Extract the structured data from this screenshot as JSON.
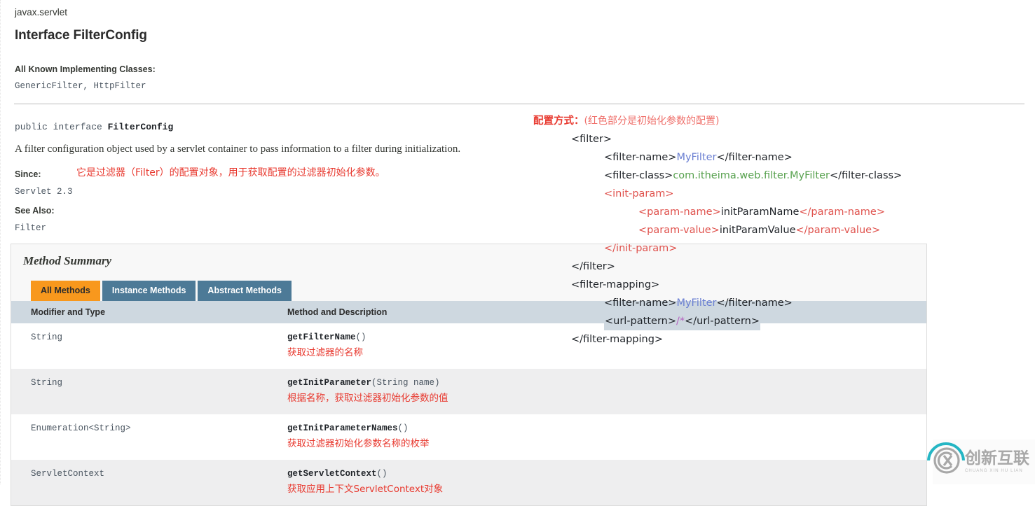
{
  "header": {
    "package": "javax.servlet",
    "title": "Interface FilterConfig",
    "known_label": "All Known Implementing Classes:",
    "known_classes": "GenericFilter, HttpFilter"
  },
  "declaration": {
    "modifiers": "public interface ",
    "name": "FilterConfig"
  },
  "description": "A filter configuration object used by a servlet container to pass information to a filter during initialization.",
  "details": {
    "since_label": "Since:",
    "since_value": "Servlet 2.3",
    "see_also_label": "See Also:",
    "see_also_value": "Filter",
    "since_note_cn": "它是过滤器（Filter）的配置对象，用于获取配置的过滤器初始化参数。"
  },
  "method_summary": {
    "caption": "Method Summary",
    "tabs": [
      {
        "label": "All Methods",
        "state": "active"
      },
      {
        "label": "Instance Methods",
        "state": "inactive"
      },
      {
        "label": "Abstract Methods",
        "state": "inactive"
      }
    ],
    "columns": [
      "Modifier and Type",
      "Method and Description"
    ],
    "rows": [
      {
        "type": "String",
        "method_name": "getFilterName",
        "method_args": "()",
        "note_cn": "获取过滤器的名称"
      },
      {
        "type": "String",
        "method_name": "getInitParameter",
        "method_args": "(String  name)",
        "note_cn": "根据名称，获取过滤器初始化参数的值"
      },
      {
        "type": "Enumeration<String>",
        "method_name": "getInitParameterNames",
        "method_args": "()",
        "note_cn": "获取过滤器初始化参数名称的枚举"
      },
      {
        "type": "ServletContext",
        "method_name": "getServletContext",
        "method_args": "()",
        "note_cn": "获取应用上下文ServletContext对象"
      }
    ]
  },
  "xml_config": {
    "heading_bold": "配置方式：",
    "heading_normal": "(红色部分是初始化参数的配置)",
    "lines": [
      {
        "indent": 0,
        "text": "<filter>"
      },
      {
        "indent": 1,
        "text": "<filter-name>MyFilter</filter-name>"
      },
      {
        "indent": 1,
        "text": "<filter-class>com.itheima.web.filter.MyFilter</filter-class>"
      },
      {
        "indent": 1,
        "text": "<init-param>"
      },
      {
        "indent": 2,
        "text": "<param-name>initParamName</param-name>"
      },
      {
        "indent": 2,
        "text": "<param-value>initParamValue</param-value>"
      },
      {
        "indent": 1,
        "text": "</init-param>"
      },
      {
        "indent": 0,
        "text": "</filter>"
      },
      {
        "indent": 0,
        "text": "<filter-mapping>"
      },
      {
        "indent": 1,
        "text": "<filter-name>MyFilter</filter-name>"
      },
      {
        "indent": 1,
        "text": "<url-pattern>/*</url-pattern>"
      },
      {
        "indent": 0,
        "text": "</filter-mapping>"
      }
    ],
    "values": {
      "filter_name": "MyFilter",
      "filter_class": "com.itheima.web.filter.MyFilter",
      "param_name": "initParamName",
      "param_value": "initParamValue",
      "url_pattern": "/*"
    }
  },
  "watermark": {
    "cn": "创新互联",
    "pinyin": "CHUANG XIN HU LIAN"
  },
  "colors": {
    "tab_active_bg": "#f8981d",
    "tab_inactive_bg": "#4d7a97",
    "table_header_bg": "#ced8e0",
    "annotation_red": "#e8392f",
    "xml_tag_red": "#e0534e",
    "value_blue": "#6a7fd2",
    "value_green": "#57a14e",
    "value_purple": "#b563c0"
  }
}
